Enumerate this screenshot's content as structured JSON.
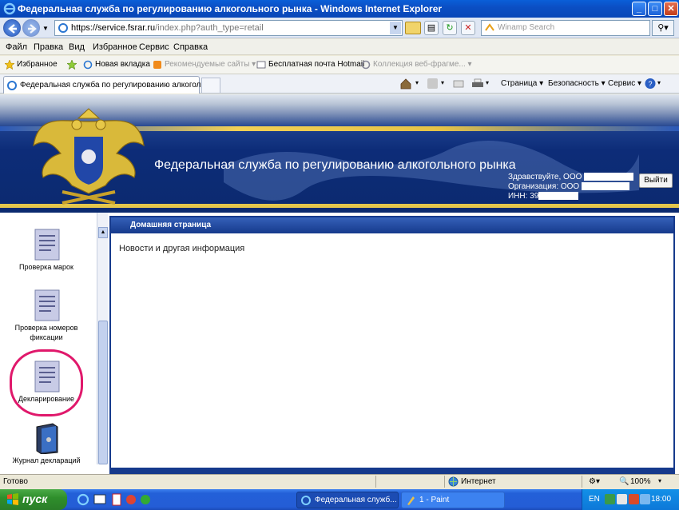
{
  "window": {
    "title": "Федеральная служба по регулированию алкогольного рынка - Windows Internet Explorer",
    "minimize": "_",
    "maximize": "□",
    "close": "✕"
  },
  "address": {
    "scheme": "https://",
    "url_host": "service.fsrar.ru",
    "url_rest": "/index.php?auth_type=retail",
    "search_placeholder": "Winamp Search"
  },
  "menu": [
    "Файл",
    "Правка",
    "Вид",
    "Избранное",
    "Сервис",
    "Справка"
  ],
  "favorites": {
    "label": "Избранное",
    "items": [
      "Новая вкладка",
      "Рекомендуемые сайты ▾",
      "Бесплатная почта Hotmail",
      "Коллекция веб-фрагме... ▾"
    ]
  },
  "tab": {
    "label": "Федеральная служба по регулированию алкоголь..."
  },
  "commands": [
    "Страница ▾",
    "Безопасность ▾",
    "Сервис ▾"
  ],
  "site": {
    "title": "Федеральная служба по регулированию алкогольного рынка",
    "greeting": "Здравствуйте, ООО",
    "org": "Организация: ООО",
    "inn": "ИНН: 39",
    "logout": "Выйти"
  },
  "sidebar": {
    "items": [
      {
        "label": "Проверка марок"
      },
      {
        "label": "Проверка номеров фиксации"
      },
      {
        "label": "Декларирование"
      },
      {
        "label": "Журнал деклараций"
      }
    ]
  },
  "panel": {
    "title": "Домашняя страница",
    "content": "Новости и другая информация"
  },
  "status": {
    "left": "Готово",
    "zone": "Интернет",
    "zoom": "100%"
  },
  "taskbar": {
    "start": "пуск",
    "tasks": [
      "Федеральная служб...",
      "1 - Paint"
    ],
    "lang": "EN",
    "time": "18:00"
  },
  "colors": {
    "banner": "#0d2c78",
    "panel_header": "#163a8c",
    "highlight": "#e0186b",
    "xp_blue": "#245dd6",
    "start_green": "#2f8f2c"
  }
}
